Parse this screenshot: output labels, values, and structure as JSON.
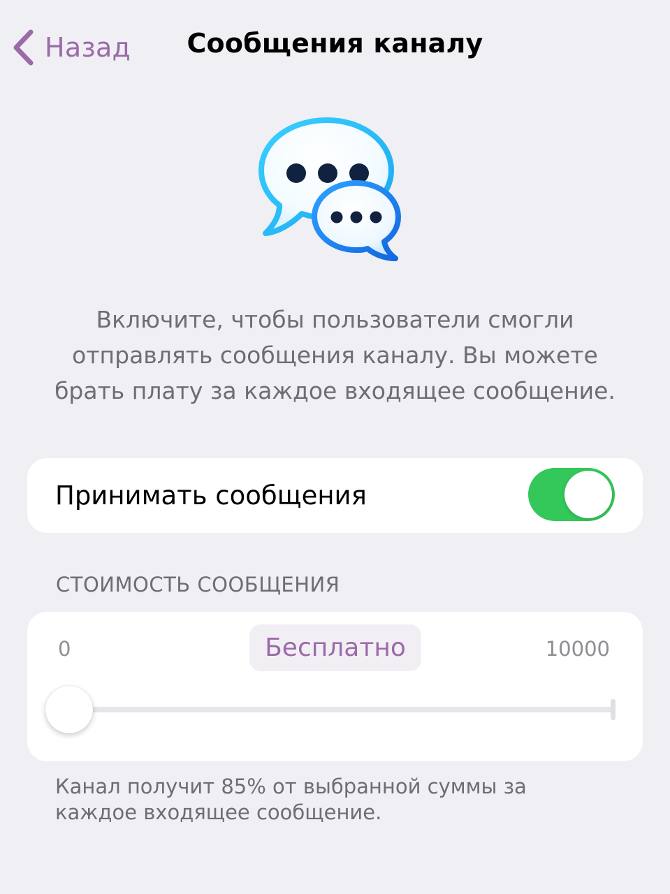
{
  "navbar": {
    "back_label": "Назад",
    "title": "Сообщения каналу"
  },
  "hero": {
    "icon": "chat-bubbles-icon"
  },
  "description": "Включите, чтобы пользователи смогли отправлять сообщения каналу. Вы можете брать плату за каждое входящее сообщение.",
  "accept_messages": {
    "label": "Принимать сообщения",
    "enabled": true,
    "color": "#34c759"
  },
  "price": {
    "section_title": "СТОИМОСТЬ СООБЩЕНИЯ",
    "min_label": "0",
    "max_label": "10000",
    "current_label": "Бесплатно",
    "value": 0,
    "min": 0,
    "max": 10000
  },
  "footer_note": "Канал получит 85% от выбранной суммы за каждое входящее сообщение.",
  "colors": {
    "accent": "#9b6aa8",
    "background": "#efeff4",
    "switch_on": "#34c759"
  }
}
